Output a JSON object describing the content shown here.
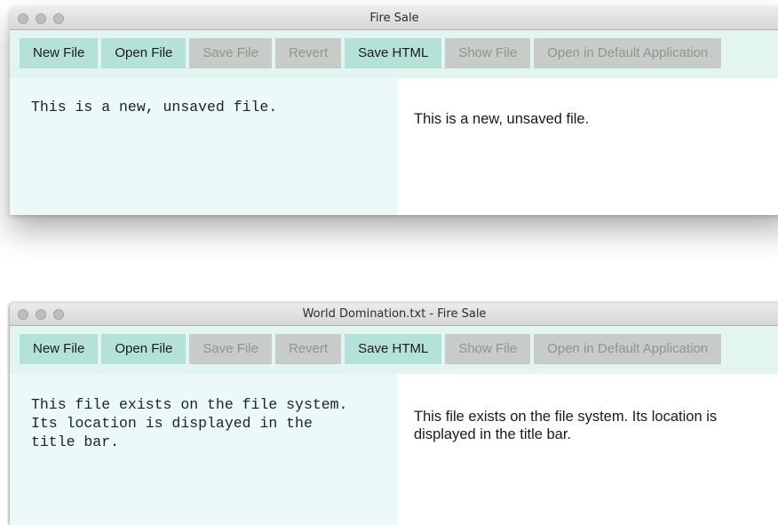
{
  "windows": [
    {
      "title": "Fire Sale",
      "toolbar": [
        {
          "label": "New File",
          "enabled": true
        },
        {
          "label": "Open File",
          "enabled": true
        },
        {
          "label": "Save File",
          "enabled": false
        },
        {
          "label": "Revert",
          "enabled": false
        },
        {
          "label": "Save HTML",
          "enabled": true
        },
        {
          "label": "Show File",
          "enabled": false
        },
        {
          "label": "Open in Default Application",
          "enabled": false
        }
      ],
      "editor_text": "This is a new, unsaved file.",
      "preview_text": "This is a new, unsaved file."
    },
    {
      "title": "World Domination.txt - Fire Sale",
      "toolbar": [
        {
          "label": "New File",
          "enabled": true
        },
        {
          "label": "Open File",
          "enabled": true
        },
        {
          "label": "Save File",
          "enabled": false
        },
        {
          "label": "Revert",
          "enabled": false
        },
        {
          "label": "Save HTML",
          "enabled": true
        },
        {
          "label": "Show File",
          "enabled": false
        },
        {
          "label": "Open in Default Application",
          "enabled": false
        }
      ],
      "editor_text": "This file exists on the file system.\nIts location is displayed in the\ntitle bar.",
      "preview_text": "This file exists on the file system. Its location is displayed in the title bar."
    }
  ],
  "colors": {
    "toolbar_bg": "#e2f5f1",
    "button_enabled": "#b4e2d8",
    "button_disabled": "#c8ccc8",
    "editor_bg": "#ebfaf8"
  }
}
